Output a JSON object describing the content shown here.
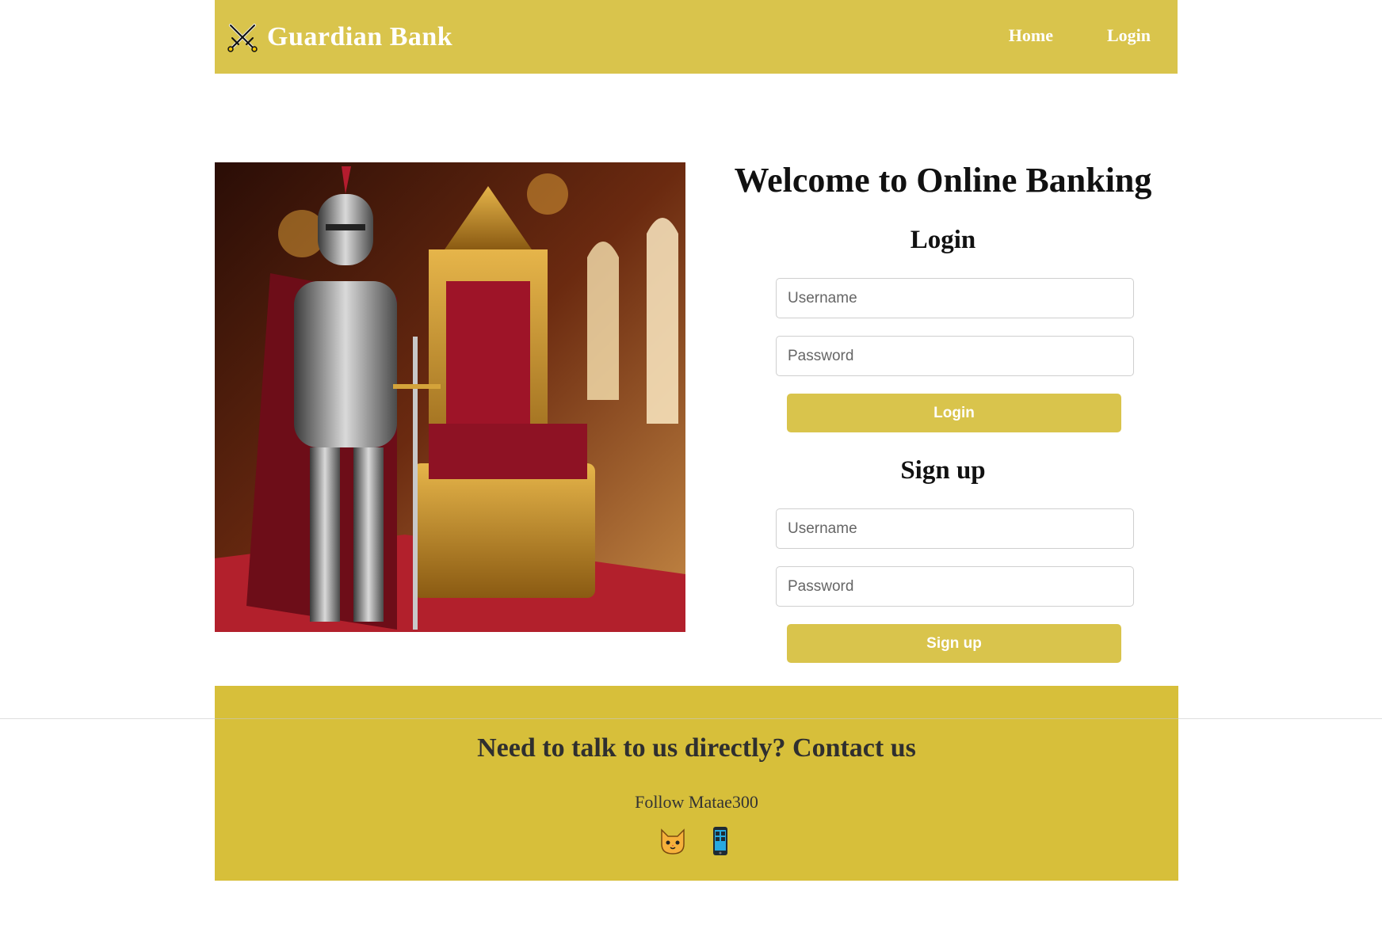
{
  "header": {
    "brand_name": "Guardian Bank",
    "brand_icon": "crossed-swords-shield-icon",
    "nav": [
      {
        "label": "Home"
      },
      {
        "label": "Login"
      }
    ]
  },
  "main": {
    "hero_image": "knight-in-armor-beside-throne",
    "welcome_title": "Welcome to Online Banking",
    "login": {
      "title": "Login",
      "username_placeholder": "Username",
      "password_placeholder": "Password",
      "button_label": "Login"
    },
    "signup": {
      "title": "Sign up",
      "username_placeholder": "Username",
      "password_placeholder": "Password",
      "button_label": "Sign up"
    }
  },
  "footer": {
    "contact_text": "Need to talk to us directly? Contact us",
    "follow_text": "Follow Matae300",
    "socials": [
      {
        "icon": "cat-face-icon"
      },
      {
        "icon": "mobile-phone-icon"
      }
    ]
  },
  "colors": {
    "accent": "#d9c44c",
    "footer": "#d7bf3a",
    "text_dark": "#111111"
  }
}
